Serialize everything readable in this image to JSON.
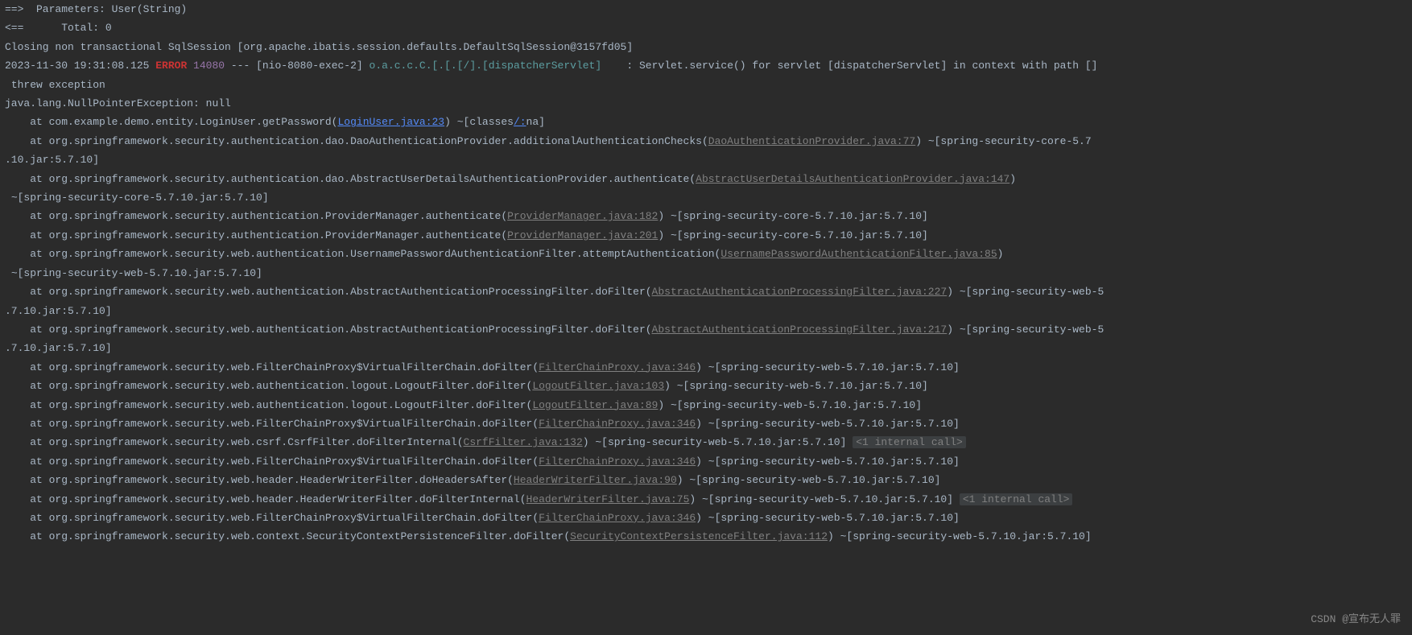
{
  "lines": {
    "param": "==>  Parameters: User(String)",
    "total": "<==      Total: 0",
    "closing": "Closing non transactional SqlSession [org.apache.ibatis.session.defaults.DefaultSqlSession@3157fd05]",
    "ts": "2023-11-30 19:31:08.125 ",
    "level": "ERROR",
    "pid": " 14080",
    "sep": " --- ",
    "thread": "[nio-8080-exec-2] ",
    "logger": "o.a.c.c.C.[.[.[/].[dispatcherServlet]",
    "spacer": "    : ",
    "msg": "Servlet.service() for servlet [dispatcherServlet] in context with path []",
    "msg2": " threw exception",
    "blank": "",
    "exception": "java.lang.NullPointerException: null",
    "st1a": "    at com.example.demo.entity.LoginUser.getPassword(",
    "st1link": "LoginUser.java:23",
    "st1b": ") ~[classes",
    "st1link2": "/:",
    "st1c": "na]",
    "st2a": "    at org.springframework.security.authentication.dao.DaoAuthenticationProvider.additionalAuthenticationChecks(",
    "st2link": "DaoAuthenticationProvider.java:77",
    "st2b": ") ~[spring-security-core-5.7",
    "st2c": ".10.jar:5.7.10]",
    "st3a": "    at org.springframework.security.authentication.dao.AbstractUserDetailsAuthenticationProvider.authenticate(",
    "st3link": "AbstractUserDetailsAuthenticationProvider.java:147",
    "st3b": ")",
    "st3c": " ~[spring-security-core-5.7.10.jar:5.7.10]",
    "st4a": "    at org.springframework.security.authentication.ProviderManager.authenticate(",
    "st4link": "ProviderManager.java:182",
    "st4b": ") ~[spring-security-core-5.7.10.jar:5.7.10]",
    "st5a": "    at org.springframework.security.authentication.ProviderManager.authenticate(",
    "st5link": "ProviderManager.java:201",
    "st5b": ") ~[spring-security-core-5.7.10.jar:5.7.10]",
    "st6a": "    at org.springframework.security.web.authentication.UsernamePasswordAuthenticationFilter.attemptAuthentication(",
    "st6link": "UsernamePasswordAuthenticationFilter.java:85",
    "st6b": ")",
    "st6c": " ~[spring-security-web-5.7.10.jar:5.7.10]",
    "st7a": "    at org.springframework.security.web.authentication.AbstractAuthenticationProcessingFilter.doFilter(",
    "st7link": "AbstractAuthenticationProcessingFilter.java:227",
    "st7b": ") ~[spring-security-web-5",
    "st7c": ".7.10.jar:5.7.10]",
    "st8a": "    at org.springframework.security.web.authentication.AbstractAuthenticationProcessingFilter.doFilter(",
    "st8link": "AbstractAuthenticationProcessingFilter.java:217",
    "st8b": ") ~[spring-security-web-5",
    "st8c": ".7.10.jar:5.7.10]",
    "st9a": "    at org.springframework.security.web.FilterChainProxy$VirtualFilterChain.doFilter(",
    "st9link": "FilterChainProxy.java:346",
    "st9b": ") ~[spring-security-web-5.7.10.jar:5.7.10]",
    "st10a": "    at org.springframework.security.web.authentication.logout.LogoutFilter.doFilter(",
    "st10link": "LogoutFilter.java:103",
    "st10b": ") ~[spring-security-web-5.7.10.jar:5.7.10]",
    "st11a": "    at org.springframework.security.web.authentication.logout.LogoutFilter.doFilter(",
    "st11link": "LogoutFilter.java:89",
    "st11b": ") ~[spring-security-web-5.7.10.jar:5.7.10]",
    "st12a": "    at org.springframework.security.web.FilterChainProxy$VirtualFilterChain.doFilter(",
    "st12link": "FilterChainProxy.java:346",
    "st12b": ") ~[spring-security-web-5.7.10.jar:5.7.10]",
    "st13a": "    at org.springframework.security.web.csrf.CsrfFilter.doFilterInternal(",
    "st13link": "CsrfFilter.java:132",
    "st13b": ") ~[spring-security-web-5.7.10.jar:5.7.10] ",
    "st13hint": "<1 internal call>",
    "st14a": "    at org.springframework.security.web.FilterChainProxy$VirtualFilterChain.doFilter(",
    "st14link": "FilterChainProxy.java:346",
    "st14b": ") ~[spring-security-web-5.7.10.jar:5.7.10]",
    "st15a": "    at org.springframework.security.web.header.HeaderWriterFilter.doHeadersAfter(",
    "st15link": "HeaderWriterFilter.java:90",
    "st15b": ") ~[spring-security-web-5.7.10.jar:5.7.10]",
    "st16a": "    at org.springframework.security.web.header.HeaderWriterFilter.doFilterInternal(",
    "st16link": "HeaderWriterFilter.java:75",
    "st16b": ") ~[spring-security-web-5.7.10.jar:5.7.10] ",
    "st16hint": "<1 internal call>",
    "st17a": "    at org.springframework.security.web.FilterChainProxy$VirtualFilterChain.doFilter(",
    "st17link": "FilterChainProxy.java:346",
    "st17b": ") ~[spring-security-web-5.7.10.jar:5.7.10]",
    "st18a": "    at org.springframework.security.web.context.SecurityContextPersistenceFilter.doFilter(",
    "st18link": "SecurityContextPersistenceFilter.java:112",
    "st18b": ") ~[spring-security-web-5.7.10.jar:5.7.10]"
  },
  "watermark": "CSDN @宣布无人罪"
}
